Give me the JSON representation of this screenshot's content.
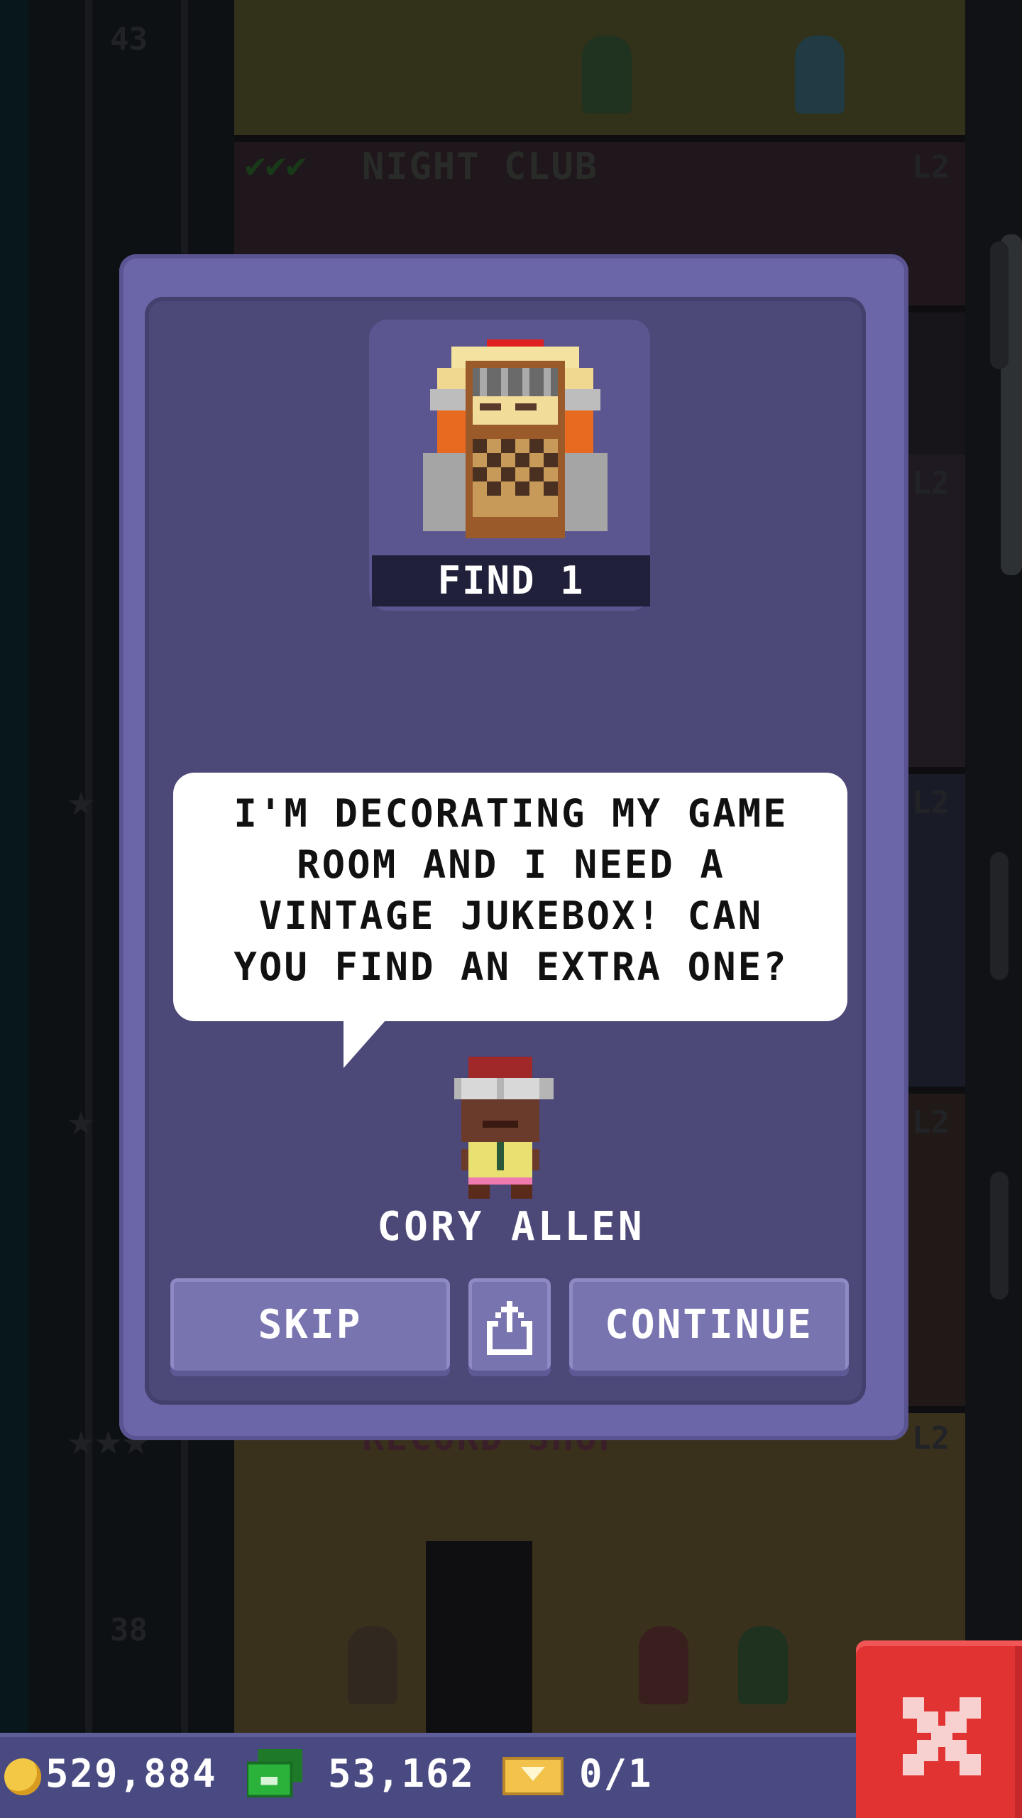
{
  "background": {
    "floors": [
      {
        "number": "43",
        "name": "",
        "level": ""
      },
      {
        "number": "",
        "name": "NIGHT CLUB",
        "level": "L2"
      },
      {
        "number": "",
        "name": "",
        "level": "L2"
      },
      {
        "number": "",
        "name": "",
        "level": "L2"
      },
      {
        "number": "",
        "name": "",
        "level": "L2"
      },
      {
        "number": "",
        "name": "RECORD SHOP",
        "level": "L2"
      },
      {
        "number": "38",
        "name": "",
        "level": ""
      }
    ]
  },
  "quest": {
    "item_icon": "jukebox-icon",
    "find_label": "FIND 1",
    "message": "I'M DECORATING MY GAME\nROOM AND I NEED A\nVINTAGE JUKEBOX! CAN\nYOU FIND AN EXTRA ONE?",
    "npc_name": "CORY ALLEN",
    "buttons": {
      "skip": "SKIP",
      "share_icon": "share-icon",
      "continue": "CONTINUE"
    }
  },
  "status_bar": {
    "coins": "529,884",
    "bux": "53,162",
    "tickets": "0/1"
  },
  "colors": {
    "modal": "#6b66a8",
    "modal_inner": "#4c4878",
    "button": "#7874b0",
    "close": "#e23333",
    "bar": "#4a4a82"
  }
}
